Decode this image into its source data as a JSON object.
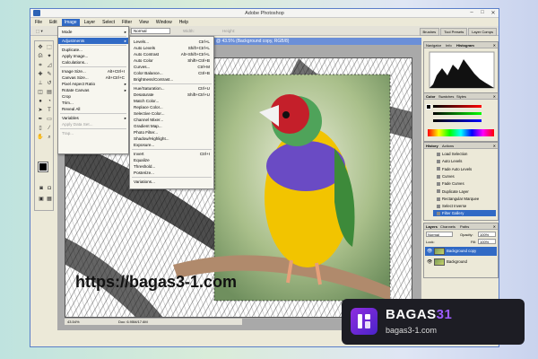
{
  "window": {
    "title": "Adobe Photoshop"
  },
  "menubar": [
    "File",
    "Edit",
    "Image",
    "Layer",
    "Select",
    "Filter",
    "View",
    "Window",
    "Help"
  ],
  "options_bar": {
    "style_label": "Style:",
    "style_value": "Normal",
    "width_label": "Width:",
    "height_label": "Height:"
  },
  "workspace_tabs": [
    "Brushes",
    "Tool Presets",
    "Layer Comps"
  ],
  "document": {
    "title": "@ 43.5% (Background copy, RGB/8)",
    "zoom": "43.54%",
    "doc_info": "Doc: 6.95M/17.6M"
  },
  "image_menu": [
    {
      "label": "Mode",
      "arrow": true
    },
    {
      "sep": true
    },
    {
      "label": "Adjustments",
      "arrow": true,
      "highlight": true
    },
    {
      "sep": true
    },
    {
      "label": "Duplicate..."
    },
    {
      "label": "Apply Image..."
    },
    {
      "label": "Calculations..."
    },
    {
      "sep": true
    },
    {
      "label": "Image Size...",
      "shortcut": "Alt+Ctrl+I"
    },
    {
      "label": "Canvas Size...",
      "shortcut": "Alt+Ctrl+C"
    },
    {
      "label": "Pixel Aspect Ratio",
      "arrow": true
    },
    {
      "label": "Rotate Canvas",
      "arrow": true
    },
    {
      "label": "Crop"
    },
    {
      "label": "Trim..."
    },
    {
      "label": "Reveal All"
    },
    {
      "sep": true
    },
    {
      "label": "Variables",
      "arrow": true
    },
    {
      "label": "Apply Data Set...",
      "disabled": true
    },
    {
      "sep": true
    },
    {
      "label": "Trap...",
      "disabled": true
    }
  ],
  "adjust_menu": [
    {
      "label": "Levels...",
      "shortcut": "Ctrl+L"
    },
    {
      "label": "Auto Levels",
      "shortcut": "Shift+Ctrl+L"
    },
    {
      "label": "Auto Contrast",
      "shortcut": "Alt+Shift+Ctrl+L"
    },
    {
      "label": "Auto Color",
      "shortcut": "Shift+Ctrl+B"
    },
    {
      "label": "Curves...",
      "shortcut": "Ctrl+M"
    },
    {
      "label": "Color Balance...",
      "shortcut": "Ctrl+B"
    },
    {
      "label": "Brightness/Contrast..."
    },
    {
      "sep": true
    },
    {
      "label": "Hue/Saturation...",
      "shortcut": "Ctrl+U"
    },
    {
      "label": "Desaturate",
      "shortcut": "Shift+Ctrl+U"
    },
    {
      "label": "Match Color..."
    },
    {
      "label": "Replace Color..."
    },
    {
      "label": "Selective Color..."
    },
    {
      "label": "Channel Mixer..."
    },
    {
      "label": "Gradient Map..."
    },
    {
      "label": "Photo Filter..."
    },
    {
      "label": "Shadow/Highlight..."
    },
    {
      "label": "Exposure..."
    },
    {
      "sep": true
    },
    {
      "label": "Invert",
      "shortcut": "Ctrl+I"
    },
    {
      "label": "Equalize"
    },
    {
      "label": "Threshold..."
    },
    {
      "label": "Posterize..."
    },
    {
      "sep": true
    },
    {
      "label": "Variations..."
    }
  ],
  "panels": {
    "navigator_tabs": [
      "Navigator",
      "Info",
      "Histogram"
    ],
    "color_tabs": [
      "Color",
      "Swatches",
      "Styles"
    ],
    "history_tabs": [
      "History",
      "Actions"
    ],
    "history_items": [
      "Load Selection",
      "Auto Levels",
      "Fade Auto Levels",
      "Curves",
      "Fade Curves",
      "Duplicate Layer",
      "Rectangular Marquee",
      "Select Inverse",
      "Filter Gallery"
    ],
    "layers_tabs": [
      "Layers",
      "Channels",
      "Paths"
    ],
    "layers_mode": "Normal",
    "layers_opacity_label": "Opacity:",
    "layers_opacity": "100%",
    "layers_lock_label": "Lock:",
    "layers_fill_label": "Fill:",
    "layers_fill": "100%",
    "layers": [
      {
        "name": "Background copy",
        "selected": true
      },
      {
        "name": "Background",
        "selected": false
      }
    ]
  },
  "watermark": {
    "url": "https://bagas3-1.com"
  },
  "badge": {
    "name_a": "BAGAS",
    "name_b": "31",
    "sub": "bagas3-1.com"
  },
  "colors": {
    "highlight": "#316ac5",
    "brand": "#9d5cff"
  }
}
